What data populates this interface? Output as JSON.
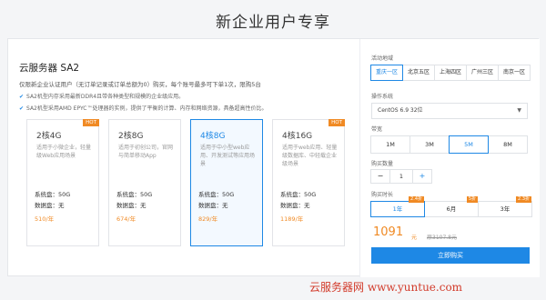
{
  "page_title": "新企业用户专享",
  "product": {
    "title": "云服务器 SA2",
    "description": "仅限新企业认证用户（无订单记录或订单总额为0）购买，每个账号最多可下单1次，限购5台",
    "features": [
      "SA2机型内存采用最新DDR4且带各种类型和规模的企业级应用。",
      "SA2机型采用AMD EPYC™处理器的实例，提供了平衡的计算、内存和网络资源，具备超高性价比。"
    ]
  },
  "plans": [
    {
      "spec": "2核4G",
      "badge": "HOT",
      "desc": "适用于小微企业，轻量级Web应用场景",
      "disk": "系统盘：50G",
      "data": "数据盘：无",
      "price": "510/年",
      "selected": false
    },
    {
      "spec": "2核8G",
      "badge": "",
      "desc": "适用于初创公司，官网与简单移动App",
      "disk": "系统盘：50G",
      "data": "数据盘：无",
      "price": "674/年",
      "selected": false
    },
    {
      "spec": "4核8G",
      "badge": "",
      "desc": "适用于中小型web应用、开发测试等应用场景",
      "disk": "系统盘：50G",
      "data": "数据盘：无",
      "price": "829/年",
      "selected": true
    },
    {
      "spec": "4核16G",
      "badge": "HOT",
      "desc": "适用于web应用、轻量级数据库、中轻载企业级场景",
      "disk": "系统盘：50G",
      "data": "数据盘：无",
      "price": "1189/年",
      "selected": false
    }
  ],
  "config": {
    "region_label": "活动地域",
    "regions": [
      "重庆一区",
      "北京五区",
      "上海四区",
      "广州三区",
      "南京一区"
    ],
    "region_selected": 0,
    "os_label": "操作系统",
    "os_value": "CentOS 6.9 32位",
    "bandwidth_label": "带宽",
    "bandwidths": [
      "1M",
      "3M",
      "5M",
      "8M"
    ],
    "bandwidth_selected": 2,
    "quantity_label": "购买数量",
    "quantity": "1",
    "duration_label": "购买时长",
    "durations": [
      {
        "label": "1年",
        "discount": "2.4折"
      },
      {
        "label": "6月",
        "discount": "5折"
      },
      {
        "label": "3年",
        "discount": "2.3折"
      }
    ],
    "duration_selected": 0,
    "total_price": "1091",
    "unit": "元",
    "original_price": "原3107.8元",
    "buy_label": "立即购买"
  },
  "watermark": "云服务器网 www.yuntue.com"
}
